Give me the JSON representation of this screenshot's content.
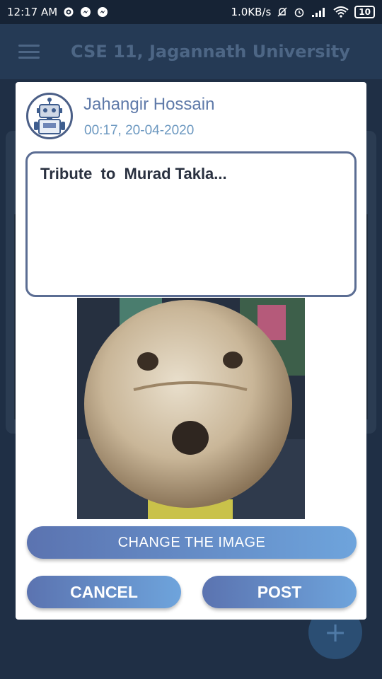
{
  "status_bar": {
    "time": "12:17 AM",
    "left_icons": [
      "gear-icon",
      "messenger-icon",
      "messenger-icon"
    ],
    "speed": "1.0KB/s",
    "right_icons": [
      "bell-off-icon",
      "alarm-icon",
      "signal-icon",
      "wifi-icon",
      "battery-icon"
    ],
    "battery": "10"
  },
  "app_bar": {
    "title": "CSE 11, Jagannath University",
    "menu_icon": "hamburger-menu-icon"
  },
  "dialog": {
    "author_name": "Jahangir Hossain",
    "timestamp": "00:17, 20-04-2020",
    "post_text": "Tribute  to  Murad Takla...",
    "change_image_label": "CHANGE THE IMAGE",
    "cancel_label": "CANCEL",
    "post_label": "POST"
  },
  "fab": {
    "label": "+"
  },
  "colors": {
    "dialog_bg": "#ffffff",
    "accent_blue": "#5f7aa9",
    "button_gradient_start": "#5b73b0",
    "button_gradient_end": "#6ea4dc",
    "overlay_bg": "#1f2f45"
  }
}
